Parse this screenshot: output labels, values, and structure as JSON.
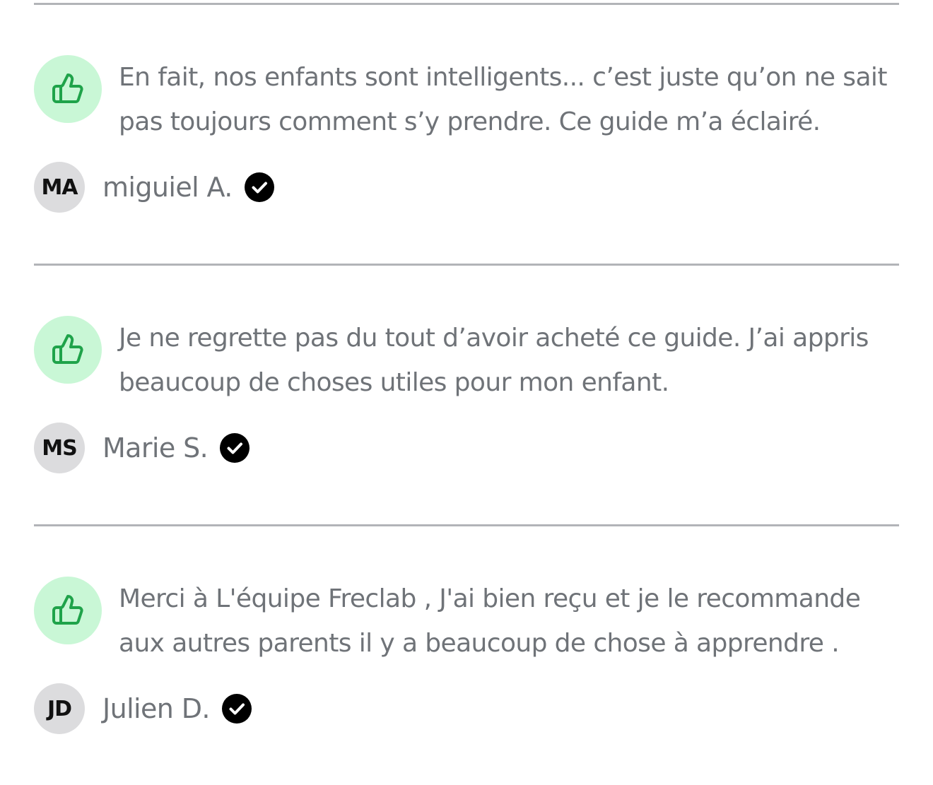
{
  "reviews": [
    {
      "text": "En fait, nos enfants sont intelligents... c’est juste qu’on ne sait pas toujours comment s’y prendre. Ce guide m’a éclairé.",
      "initials": "MA",
      "author": "miguiel A.",
      "icon": "thumbs-up-icon",
      "badge_icon": "verified-check-icon"
    },
    {
      "text": "Je ne regrette pas du tout d’avoir acheté ce guide. J’ai appris beaucoup de choses utiles pour mon enfant.",
      "initials": "MS",
      "author": "Marie S.",
      "icon": "thumbs-up-icon",
      "badge_icon": "verified-check-icon"
    },
    {
      "text": "Merci à L'équipe Freclab , J'ai bien reçu et je le recommande aux autres parents il y a beaucoup de chose à apprendre .",
      "initials": "JD",
      "author": "Julien D.",
      "icon": "thumbs-up-icon",
      "badge_icon": "verified-check-icon"
    }
  ],
  "colors": {
    "thumb_bg": "#c9f7d6",
    "thumb_icon": "#1fa34a",
    "text": "#6f7378",
    "divider": "#b2b4b8",
    "avatar_bg": "#dcdcde",
    "badge": "#000000"
  }
}
